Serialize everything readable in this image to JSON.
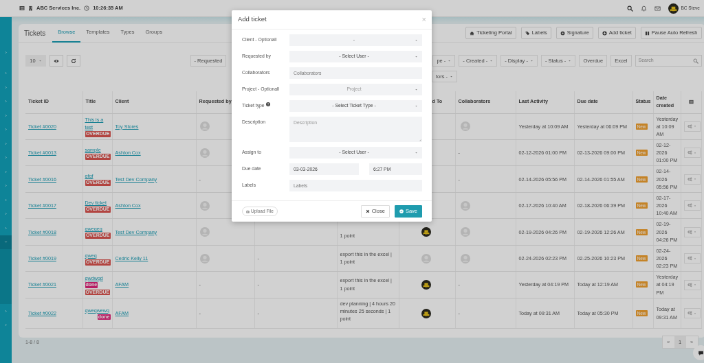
{
  "topbar": {
    "company": "ABC Services Inc.",
    "time": "10:26:35 AM",
    "user": "BC Steve"
  },
  "sidebar": {
    "items": [
      {
        "expanded": false
      },
      {
        "expanded": false
      },
      {
        "expanded": false
      },
      {
        "expanded": false
      },
      {
        "expanded": false
      },
      {
        "expanded": false
      },
      {
        "expanded": false
      },
      {
        "expanded": false
      },
      {
        "expanded": false
      },
      {
        "expanded": false
      },
      {
        "expanded": false
      },
      {
        "expanded": false
      },
      {
        "expanded": false
      },
      {
        "expanded": true
      },
      {
        "expanded": false
      },
      {
        "expanded": false
      }
    ]
  },
  "page": {
    "title": "Tickets",
    "tabs": [
      {
        "label": "Browse",
        "selected": true
      },
      {
        "label": "Templates",
        "selected": false
      },
      {
        "label": "Types",
        "selected": false
      },
      {
        "label": "Groups",
        "selected": false
      }
    ],
    "actions": [
      "Ticketing Portal",
      "Labels",
      "Signature",
      "Add ticket",
      "Pause Auto Refresh"
    ]
  },
  "toolbar": {
    "page_size": "10",
    "filters": [
      {
        "label": "- Requested",
        "caret": false
      },
      {
        "label": "pe -",
        "caret": true
      },
      {
        "label": "- Created -",
        "caret": true
      },
      {
        "label": "- Display -",
        "caret": true
      },
      {
        "label": "- Status -",
        "caret": true
      }
    ],
    "buttons": [
      "Overdue",
      "Excel"
    ],
    "search": {
      "placeholder": "Search"
    },
    "filters_row_2": [
      {
        "label": "tors -",
        "caret": true
      }
    ]
  },
  "table": {
    "columns": [
      {
        "kind": "text",
        "label": "Ticket ID"
      },
      {
        "kind": "text",
        "label": "Title"
      },
      {
        "kind": "text",
        "label": "Client"
      },
      {
        "kind": "text",
        "label": "Requested by"
      },
      null,
      null,
      {
        "kind": "text",
        "label": "d To"
      },
      {
        "kind": "text",
        "label": "Collaborators"
      },
      {
        "kind": "text",
        "label": "Last Activity"
      },
      {
        "kind": "text",
        "label": "Due date"
      },
      {
        "kind": "text",
        "label": "Status"
      },
      {
        "kind": "text",
        "label": "Date created"
      },
      {
        "kind": "menu"
      }
    ],
    "rows": [
      {
        "cells": [
          {
            "kind": "link",
            "text": "Ticket #0020"
          },
          {
            "kind": "title",
            "text": "This is a test",
            "labels": [
              {
                "text": "OVERDUE",
                "color": "#b24441"
              }
            ]
          },
          {
            "kind": "link",
            "text": "Toy Stores"
          },
          {
            "kind": "person"
          },
          null,
          null,
          null,
          {
            "kind": "person"
          },
          {
            "kind": "text",
            "text": "Yesterday at 10:09 AM"
          },
          {
            "kind": "text",
            "text": "Yesterday at 06:09 PM"
          },
          {
            "kind": "status",
            "text": "New"
          },
          {
            "kind": "text",
            "text": "Yesterday at 10:09 AM"
          },
          {
            "kind": "actions"
          }
        ]
      },
      {
        "cells": [
          {
            "kind": "link",
            "text": "Ticket #0013"
          },
          {
            "kind": "title",
            "text": "sample",
            "labels": [
              {
                "text": "OVERDUE",
                "color": "#b24441"
              }
            ]
          },
          {
            "kind": "link",
            "text": "Ashton Cox"
          },
          {
            "kind": "person"
          },
          null,
          null,
          null,
          {
            "kind": "text",
            "text": "-"
          },
          {
            "kind": "text",
            "text": "02-12-2026 01:00 PM"
          },
          {
            "kind": "text",
            "text": "02-13-2026 09:00 PM"
          },
          {
            "kind": "status",
            "text": "New"
          },
          {
            "kind": "text",
            "text": "02-12-2026 01:00 PM"
          },
          {
            "kind": "actions"
          }
        ]
      },
      {
        "cells": [
          {
            "kind": "link",
            "text": "Ticket #0016"
          },
          {
            "kind": "title",
            "text": "gfgf",
            "labels": [
              {
                "text": "OVERDUE",
                "color": "#b24441"
              }
            ]
          },
          {
            "kind": "link",
            "text": "Test Dev Company"
          },
          {
            "kind": "text",
            "text": "-"
          },
          null,
          null,
          null,
          {
            "kind": "text",
            "text": "-"
          },
          {
            "kind": "text",
            "text": "02-14-2026 05:56 PM"
          },
          {
            "kind": "text",
            "text": "02-14-2026 01:55 AM"
          },
          {
            "kind": "status",
            "text": "New"
          },
          {
            "kind": "text",
            "text": "02-14-2026 05:56 PM"
          },
          {
            "kind": "actions"
          }
        ]
      },
      {
        "cells": [
          {
            "kind": "link",
            "text": "Ticket #0017"
          },
          {
            "kind": "title",
            "text": "Dev ticket",
            "labels": [
              {
                "text": "OVERDUE",
                "color": "#b24441"
              }
            ]
          },
          {
            "kind": "link",
            "text": "Ashton Cox"
          },
          {
            "kind": "person"
          },
          null,
          null,
          null,
          {
            "kind": "person"
          },
          {
            "kind": "text",
            "text": "02-17-2026 10:40 AM"
          },
          {
            "kind": "text",
            "text": "02-18-2026 06:39 PM"
          },
          {
            "kind": "status",
            "text": "New"
          },
          {
            "kind": "text",
            "text": "02-17-2026 10:40 AM"
          },
          {
            "kind": "actions"
          }
        ]
      },
      {
        "cells": [
          {
            "kind": "link",
            "text": "Ticket #0018"
          },
          {
            "kind": "title",
            "text": "qweqeq",
            "labels": [
              {
                "text": "OVERDUE",
                "color": "#b24441"
              }
            ]
          },
          {
            "kind": "link",
            "text": "Test Dev Company"
          },
          {
            "kind": "person"
          },
          null,
          {
            "kind": "text",
            "text": "1 point"
          },
          {
            "kind": "logo"
          },
          {
            "kind": "person"
          },
          {
            "kind": "text",
            "text": "02-19-2026 04:26 PM"
          },
          {
            "kind": "text",
            "text": "02-19-2026 12:26 AM"
          },
          {
            "kind": "status",
            "text": "New"
          },
          {
            "kind": "text",
            "text": "02-19-2026 04:26 PM"
          },
          {
            "kind": "actions"
          }
        ]
      },
      {
        "cells": [
          {
            "kind": "link",
            "text": "Ticket #0019"
          },
          {
            "kind": "title",
            "text": "qweq",
            "labels": [
              {
                "text": "OVERDUE",
                "color": "#b24441"
              }
            ]
          },
          {
            "kind": "link",
            "text": "Cedric Kelly 11"
          },
          {
            "kind": "person"
          },
          {
            "kind": "text",
            "text": "-"
          },
          {
            "kind": "text",
            "text": "export this in the excel | 1 point"
          },
          {
            "kind": "person"
          },
          {
            "kind": "person"
          },
          {
            "kind": "text",
            "text": "02-24-2026 02:23 PM"
          },
          {
            "kind": "text",
            "text": "02-25-2026 10:23 PM"
          },
          {
            "kind": "status",
            "text": "New"
          },
          {
            "kind": "text",
            "text": "02-24-2026 02:23 PM"
          },
          {
            "kind": "actions"
          }
        ]
      },
      {
        "cells": [
          {
            "kind": "link",
            "text": "Ticket #0021"
          },
          {
            "kind": "title",
            "text": "qwdwqd",
            "labels": [
              {
                "text": "done",
                "color": "#b81e65"
              },
              {
                "text": "OVERDUE",
                "color": "#b24441"
              }
            ]
          },
          {
            "kind": "link",
            "text": "AFAM"
          },
          {
            "kind": "text",
            "text": "-"
          },
          {
            "kind": "text",
            "text": "-"
          },
          {
            "kind": "text",
            "text": "export this in the excel | 1 point"
          },
          {
            "kind": "logo"
          },
          {
            "kind": "text",
            "text": "-"
          },
          {
            "kind": "text",
            "text": "Yesterday at 04:19 PM"
          },
          {
            "kind": "text",
            "text": "Today at 12:19 AM"
          },
          {
            "kind": "status",
            "text": "New"
          },
          {
            "kind": "text",
            "text": "Yesterday at 04:19 PM"
          },
          {
            "kind": "actions"
          }
        ]
      },
      {
        "cells": [
          {
            "kind": "link",
            "text": "Ticket #0022"
          },
          {
            "kind": "title",
            "text": "qweqwewq",
            "labels": [
              {
                "text": "done",
                "color": "#b81e65"
              }
            ]
          },
          {
            "kind": "link",
            "text": "AFAM"
          },
          {
            "kind": "text",
            "text": "-"
          },
          {
            "kind": "text",
            "text": "-"
          },
          {
            "kind": "text",
            "text": "dev planning | 4 hours 20 minutes 25 seconds | 1 point"
          },
          {
            "kind": "logo"
          },
          {
            "kind": "text",
            "text": "-"
          },
          {
            "kind": "text",
            "text": "Today at 09:31 AM"
          },
          {
            "kind": "text",
            "text": "Today at 05:30 PM"
          },
          {
            "kind": "status",
            "text": "New"
          },
          {
            "kind": "text",
            "text": "Today at 09:31 AM"
          },
          {
            "kind": "actions"
          }
        ]
      }
    ],
    "summary": "1-8 / 8",
    "pagination": [
      {
        "kind": "prev",
        "label": "«",
        "selected": false
      },
      {
        "kind": "page",
        "label": "1",
        "selected": true
      },
      {
        "kind": "next",
        "label": "»",
        "selected": false
      }
    ]
  },
  "modal": {
    "title": "Add ticket",
    "close": "×",
    "fields": [
      {
        "label": "Client - Optionall",
        "kind": "select",
        "value": "-"
      },
      {
        "label": "Requested by",
        "kind": "select",
        "value": "- Select User -"
      },
      {
        "label": "Collaborators",
        "kind": "input",
        "placeholder": "Collaborators"
      },
      {
        "label": "Project - Optionall",
        "kind": "select",
        "placeholder": "Project"
      },
      {
        "label": "Ticket type",
        "help": true,
        "kind": "select",
        "value": "- Select Ticket Type -"
      },
      {
        "label": "Description",
        "kind": "textarea",
        "placeholder": "Description"
      },
      {
        "label": "Assign to",
        "kind": "select",
        "value": "- Select User -"
      },
      {
        "label": "Due date",
        "kind": "datetime",
        "date": "03-03-2026",
        "time": "6:27 PM"
      },
      {
        "label": "Labels",
        "kind": "input",
        "placeholder": "Labels"
      }
    ],
    "upload": "Upload File",
    "buttons": [
      {
        "label": "Close",
        "kind": "close"
      },
      {
        "label": "Save",
        "kind": "save"
      }
    ]
  }
}
